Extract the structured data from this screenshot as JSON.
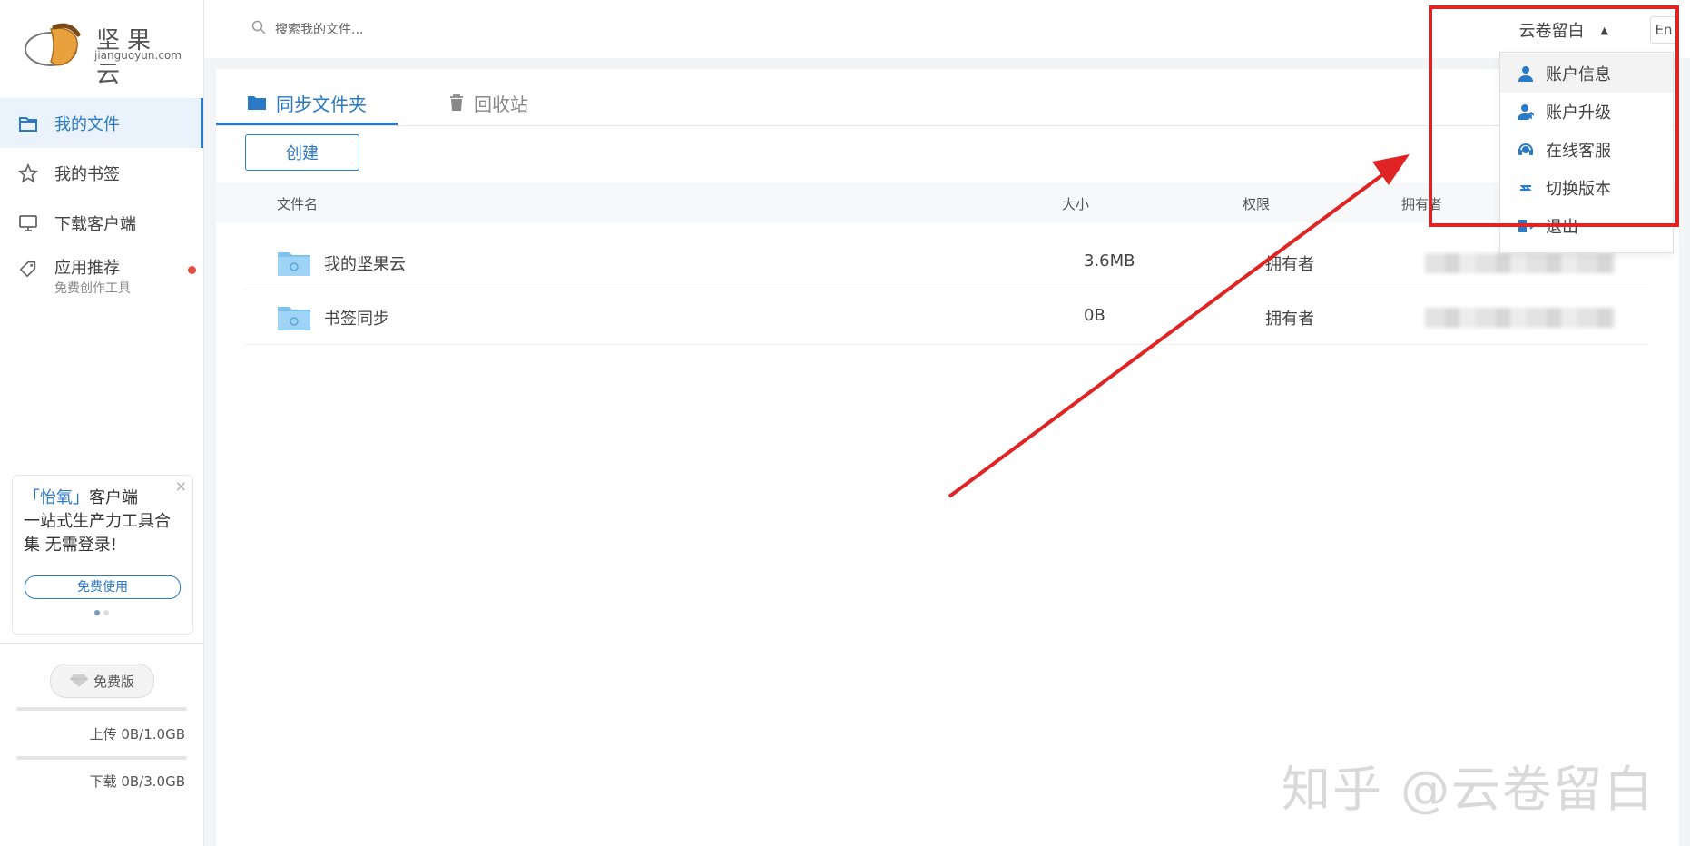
{
  "brand": {
    "name": "坚果云",
    "sub": "jianguoyun.com"
  },
  "sidebar": {
    "items": [
      {
        "label": "我的文件",
        "sub": ""
      },
      {
        "label": "我的书签",
        "sub": ""
      },
      {
        "label": "下载客户端",
        "sub": ""
      },
      {
        "label": "应用推荐",
        "sub": "免费创作工具"
      }
    ],
    "promo": {
      "line1_accent": "「怡氧」",
      "line1_rest": "客户端",
      "line2": "一站式生产力工具合",
      "line3": "集 无需登录!",
      "button": "免费使用",
      "close": "×"
    },
    "plan": {
      "badge": "免费版",
      "upload": "上传 0B/1.0GB",
      "download": "下载 0B/3.0GB"
    }
  },
  "topbar": {
    "search_placeholder": "搜索我的文件...",
    "user_name": "云卷留白",
    "lang": "En"
  },
  "tabs": [
    {
      "label": "同步文件夹"
    },
    {
      "label": "回收站"
    }
  ],
  "toolbar": {
    "create_label": "创建"
  },
  "table": {
    "headers": {
      "name": "文件名",
      "size": "大小",
      "perm": "权限",
      "owner": "拥有者"
    },
    "rows": [
      {
        "name": "我的坚果云",
        "size": "3.6MB",
        "perm": "拥有者"
      },
      {
        "name": "书签同步",
        "size": "0B",
        "perm": "拥有者"
      }
    ]
  },
  "dropdown": {
    "items": [
      {
        "label": "账户信息"
      },
      {
        "label": "账户升级"
      },
      {
        "label": "在线客服"
      },
      {
        "label": "切换版本"
      },
      {
        "label": "退出"
      }
    ]
  },
  "watermark": "知乎 @云卷留白",
  "colors": {
    "accent": "#2a7ac7",
    "annotation": "#e02424",
    "alert_dot": "#e74c3c"
  }
}
